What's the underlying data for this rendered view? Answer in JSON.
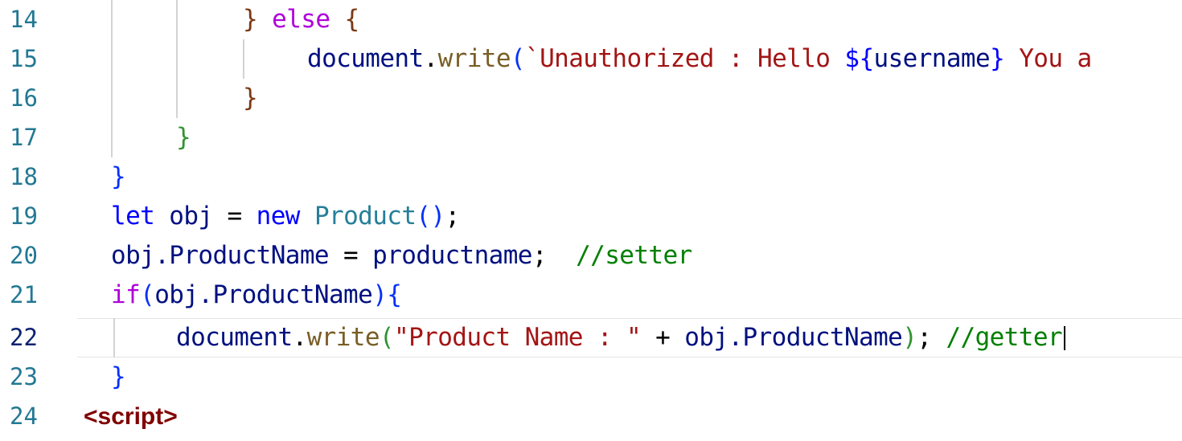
{
  "editor": {
    "lines": [
      {
        "number": "14"
      },
      {
        "number": "15"
      },
      {
        "number": "16"
      },
      {
        "number": "17"
      },
      {
        "number": "18"
      },
      {
        "number": "19"
      },
      {
        "number": "20"
      },
      {
        "number": "21"
      },
      {
        "number": "22"
      },
      {
        "number": "23"
      },
      {
        "number": "24"
      }
    ],
    "code": {
      "l14": {
        "brace_close": "}",
        "else": "else",
        "brace_open": "{"
      },
      "l15": {
        "obj": "document",
        "dot": ".",
        "method": "write",
        "paren": "(",
        "string": "`Unauthorized : Hello ",
        "tmpl_open": "${",
        "var": "username",
        "tmpl_close": "}",
        "string_tail": " You a"
      },
      "l16": {
        "brace": "}"
      },
      "l17": {
        "brace": "}"
      },
      "l18": {
        "brace": "}"
      },
      "l19": {
        "let": "let",
        "name": " obj ",
        "eq": "=",
        "new": " new ",
        "cls": "Product",
        "parens": "()",
        "semi": ";"
      },
      "l20": {
        "lhs": "obj.ProductName",
        "eq": " = ",
        "rhs": "productname",
        "semi": ";",
        "comment": "  //setter"
      },
      "l21": {
        "if": "if",
        "paren_open": "(",
        "cond": "obj.ProductName",
        "paren_close": ")",
        "brace": "{"
      },
      "l22": {
        "obj": "document",
        "dot": ".",
        "method": "write",
        "paren_open": "(",
        "string": "\"Product Name : \"",
        "plus": " + ",
        "arg": "obj.ProductName",
        "paren_close": ")",
        "semi": ";",
        "comment": " //getter"
      },
      "l23": {
        "brace": "}"
      },
      "l24": {
        "tag": "<script>"
      }
    }
  },
  "colors": {
    "line_number": "#237893",
    "keyword": "#0000ff",
    "control": "#af00db",
    "function": "#795e26",
    "string": "#a31515",
    "variable": "#001080",
    "class": "#267f99",
    "comment": "#008000",
    "tag": "#800000"
  }
}
